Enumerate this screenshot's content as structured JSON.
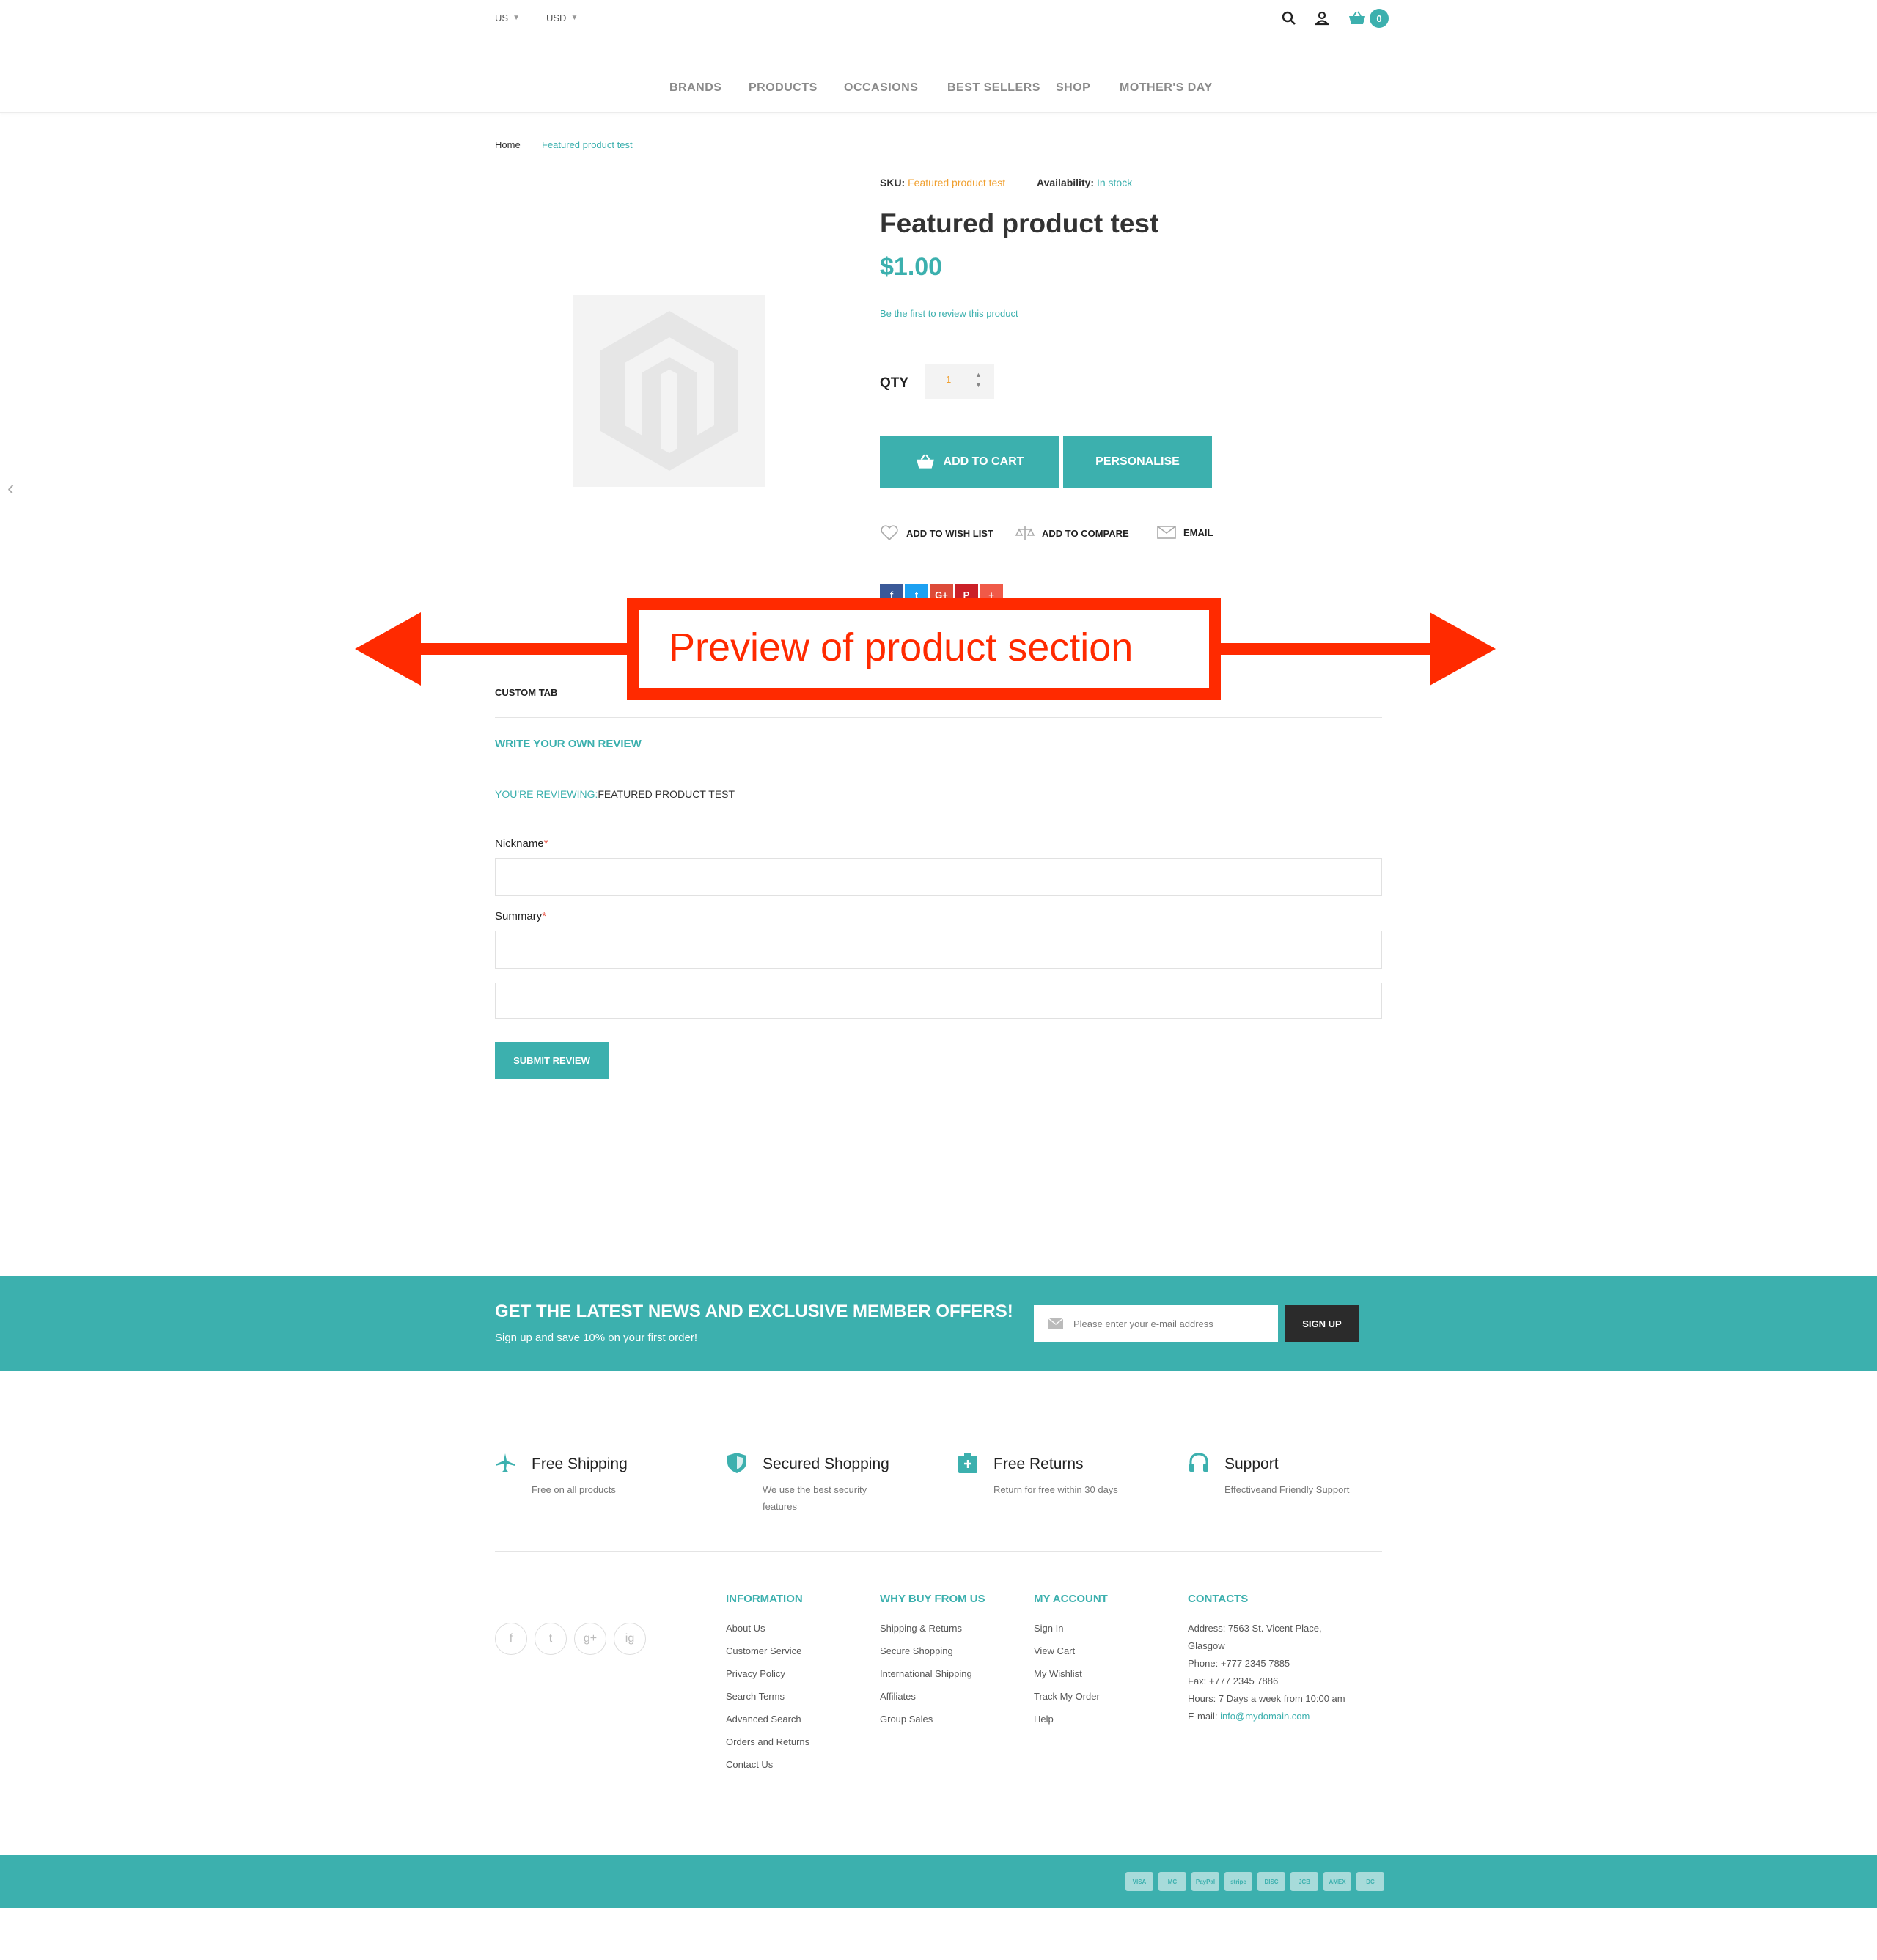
{
  "header": {
    "country": "US",
    "currency": "USD",
    "cart_count": "0"
  },
  "nav": [
    "BRANDS",
    "PRODUCTS",
    "OCCASIONS",
    "BEST SELLERS",
    "SHOP",
    "MOTHER'S DAY"
  ],
  "breadcrumb": {
    "home": "Home",
    "current": "Featured product test"
  },
  "product": {
    "sku_label": "SKU:",
    "sku": "Featured product test",
    "availability_label": "Availability:",
    "availability": "In stock",
    "title": "Featured product test",
    "price": "$1.00",
    "review_link": "Be the first to review this product",
    "qty_label": "QTY",
    "qty": "1",
    "add_to_cart": "ADD TO CART",
    "personalise": "PERSONALISE",
    "wishlist": "ADD TO WISH LIST",
    "compare": "ADD TO COMPARE",
    "email": "EMAIL"
  },
  "annotation": {
    "text": "Preview of product section"
  },
  "tabs": {
    "custom": "CUSTOM TAB"
  },
  "review_form": {
    "heading": "WRITE YOUR OWN REVIEW",
    "reviewing_label": "YOU'RE REVIEWING:",
    "reviewing_product": "FEATURED PRODUCT TEST",
    "nickname_label": "Nickname",
    "summary_label": "Summary",
    "required_mark": "*",
    "submit": "SUBMIT REVIEW"
  },
  "newsletter": {
    "title": "GET THE LATEST NEWS AND EXCLUSIVE MEMBER OFFERS!",
    "subtitle": "Sign up and save 10% on your first order!",
    "placeholder": "Please enter your e-mail address",
    "button": "SIGN UP"
  },
  "features": [
    {
      "title": "Free Shipping",
      "desc1": "Free on all products",
      "desc2": ""
    },
    {
      "title": "Secured Shopping",
      "desc1": "We use the best security",
      "desc2": "features"
    },
    {
      "title": "Free Returns",
      "desc1": "Return for free within 30 days",
      "desc2": ""
    },
    {
      "title": "Support",
      "desc1": "Effectiveand Friendly Support",
      "desc2": ""
    }
  ],
  "footer": {
    "information": {
      "title": "INFORMATION",
      "links": [
        "About Us",
        "Customer Service",
        "Privacy Policy",
        "Search Terms",
        "Advanced Search",
        "Orders and Returns",
        "Contact Us"
      ]
    },
    "why": {
      "title": "WHY BUY FROM US",
      "links": [
        "Shipping & Returns",
        "Secure Shopping",
        "International Shipping",
        "Affiliates",
        "Group Sales"
      ]
    },
    "account": {
      "title": "MY ACCOUNT",
      "links": [
        "Sign In",
        "View Cart",
        "My Wishlist",
        "Track My Order",
        "Help"
      ]
    },
    "contacts": {
      "title": "CONTACTS",
      "address1": "Address: 7563 St. Vicent Place,",
      "address2": "Glasgow",
      "phone": "Phone: +777 2345 7885",
      "fax": "Fax: +777 2345 7886",
      "hours": "Hours: 7 Days a week from 10:00 am",
      "email_label": "E-mail: ",
      "email": "info@mydomain.com"
    },
    "social": [
      "f",
      "t",
      "g+",
      "ig"
    ]
  },
  "payments": [
    "VISA",
    "MC",
    "PayPal",
    "stripe",
    "DISC",
    "JCB",
    "AMEX",
    "DC"
  ],
  "colors": {
    "accent": "#3cb0ae",
    "annotation": "#ff2a00",
    "dark": "#2b2b2b"
  }
}
